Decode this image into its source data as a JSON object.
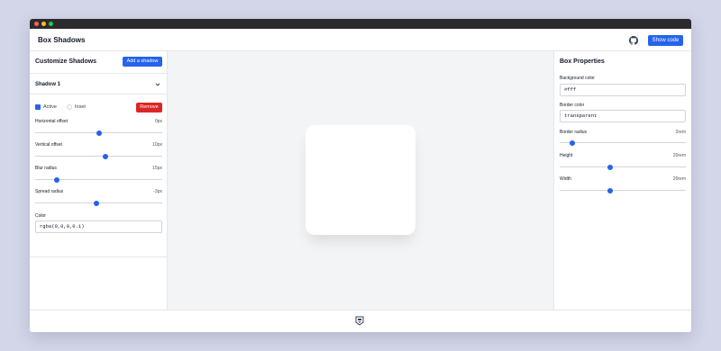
{
  "app": {
    "title": "Box Shadows"
  },
  "header": {
    "show_code_label": "Show code"
  },
  "left_panel": {
    "title": "Customize Shadows",
    "add_shadow_label": "Add a shadow",
    "shadow": {
      "title": "Shadow 1",
      "active_label": "Active",
      "active_checked": true,
      "inset_label": "Inset",
      "inset_checked": false,
      "remove_label": "Remove",
      "controls": [
        {
          "label": "Horizontal offset",
          "value": "0px",
          "fraction": 0.5
        },
        {
          "label": "Vertical offset",
          "value": "10px",
          "fraction": 0.55
        },
        {
          "label": "Blur radius",
          "value": "15px",
          "fraction": 0.17
        },
        {
          "label": "Spread radius",
          "value": "-3px",
          "fraction": 0.485
        }
      ],
      "color_label": "Color",
      "color_value": "rgba(0,0,0,0.1)"
    }
  },
  "right_panel": {
    "title": "Box Properties",
    "background_color_label": "Background color",
    "background_color_value": "#fff",
    "border_color_label": "Border color",
    "border_color_value": "transparent",
    "sliders": [
      {
        "label": "Border radius",
        "value": "2rem",
        "fraction": 0.1
      },
      {
        "label": "Height",
        "value": "20rem",
        "fraction": 0.4
      },
      {
        "label": "Width",
        "value": "20rem",
        "fraction": 0.4
      }
    ]
  },
  "icons": {
    "github": "github-icon",
    "chevron": "chevron-down-icon",
    "footer_logo": "logo-icon"
  },
  "colors": {
    "accent": "#2563eb",
    "danger": "#dc2626",
    "page_background": "#d3d6e9",
    "preview_background": "#f3f4f6"
  }
}
